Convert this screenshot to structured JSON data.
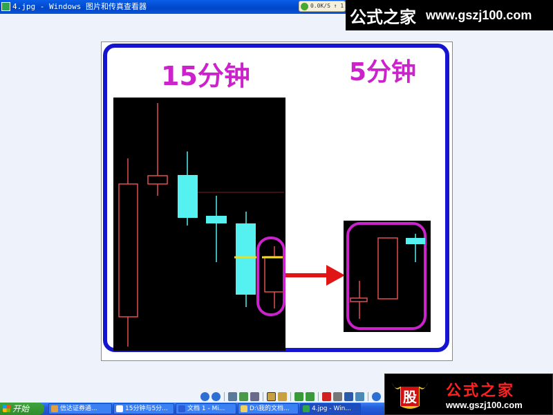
{
  "window": {
    "title": "4.jpg - Windows 图片和传真查看器",
    "net_widget": "0.0K/S ↑ 1."
  },
  "brand_top": {
    "name": "公式之家",
    "url": "www.gszj100.com"
  },
  "image": {
    "label_15min": "15分钟",
    "label_5min": "5分钟",
    "colors": {
      "frame": "#1515d0",
      "label": "#cc22cc",
      "panel": "#000000",
      "bull": "#e05050",
      "bear": "#55f0f0",
      "highlight": "#cc22cc",
      "arrow": "#e01515",
      "yellow_line": "#e8e020"
    }
  },
  "toolbar": {
    "buttons": [
      "previous-icon",
      "next-icon",
      "best-fit-icon",
      "actual-size-icon",
      "slideshow-icon",
      "zoom-in-icon",
      "zoom-out-icon",
      "rotate-cw-icon",
      "rotate-ccw-icon",
      "delete-icon",
      "print-icon",
      "save-icon",
      "edit-icon",
      "help-icon"
    ]
  },
  "taskbar": {
    "start_label": "开始",
    "items": [
      {
        "label": "信达证券通..."
      },
      {
        "label": "15分钟与5分..."
      },
      {
        "label": "文档 1 - Mi..."
      },
      {
        "label": "D:\\我的文档..."
      },
      {
        "label": "4.jpg - Win..."
      }
    ]
  },
  "brand_bottom": {
    "logo_char": "股",
    "name": "公式之家",
    "url": "www.gszj100.com"
  }
}
